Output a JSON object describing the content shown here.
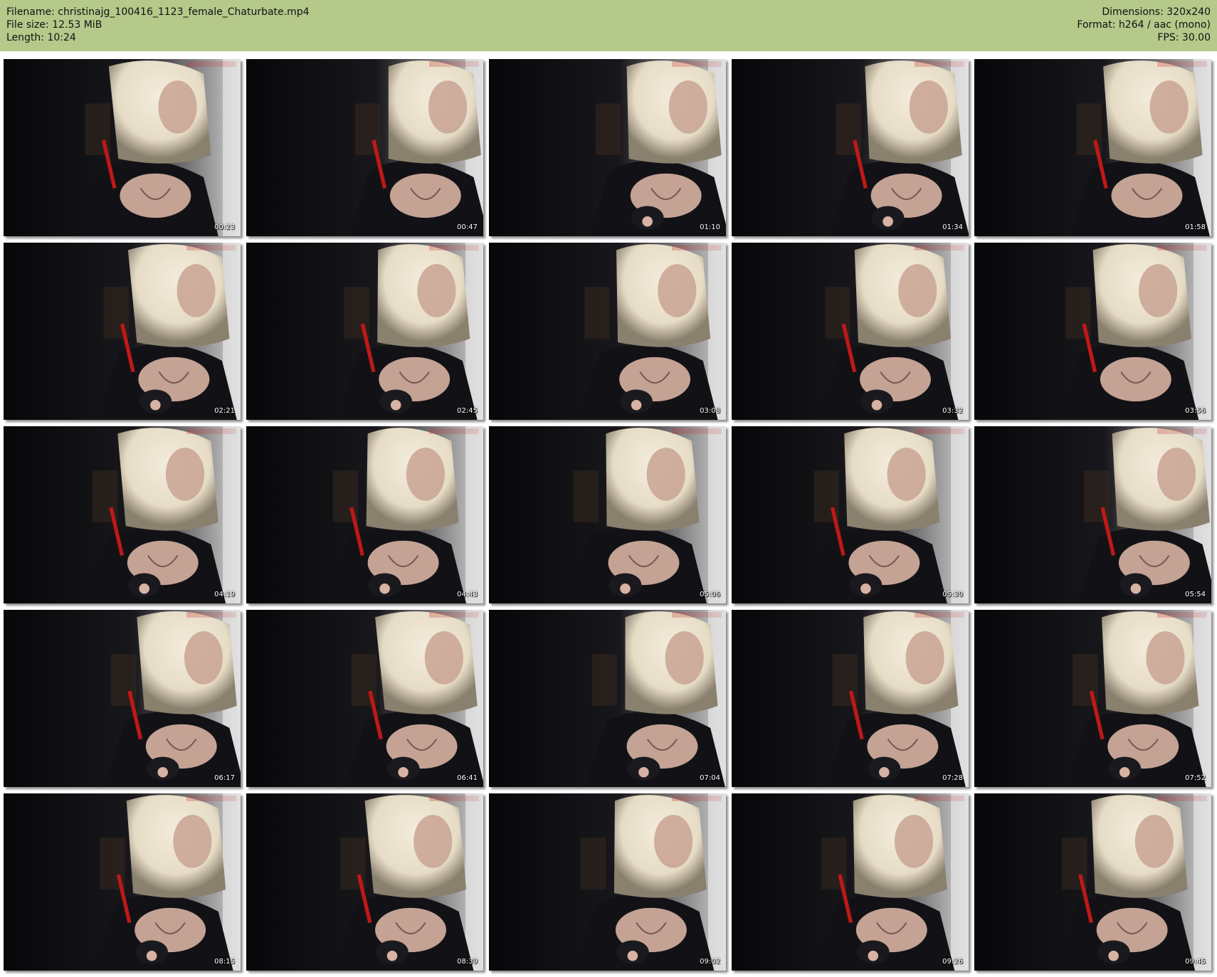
{
  "header": {
    "filename": "Filename: christinajg_100416_1123_female_Chaturbate.mp4",
    "file_size": "File size: 12.53 MiB",
    "length": "Length: 10:24",
    "dimensions": "Dimensions: 320x240",
    "format": "Format: h264 / aac (mono)",
    "fps": "FPS: 30.00"
  },
  "colors": {
    "header_background": "#b4c98a",
    "page_background": "#ffffff",
    "frame_dark": "#0e0e10",
    "hair_light": "#e6dcc6",
    "skin": "#d8b2a2",
    "accent_red": "#c01818"
  },
  "thumbnails": [
    {
      "time": "00:23"
    },
    {
      "time": "00:47"
    },
    {
      "time": "01:10"
    },
    {
      "time": "01:34"
    },
    {
      "time": "01:58"
    },
    {
      "time": "02:21"
    },
    {
      "time": "02:45"
    },
    {
      "time": "03:08"
    },
    {
      "time": "03:32"
    },
    {
      "time": "03:56"
    },
    {
      "time": "04:19"
    },
    {
      "time": "04:43"
    },
    {
      "time": "05:06"
    },
    {
      "time": "05:30"
    },
    {
      "time": "05:54"
    },
    {
      "time": "06:17"
    },
    {
      "time": "06:41"
    },
    {
      "time": "07:04"
    },
    {
      "time": "07:28"
    },
    {
      "time": "07:52"
    },
    {
      "time": "08:15"
    },
    {
      "time": "08:39"
    },
    {
      "time": "09:02"
    },
    {
      "time": "09:26"
    },
    {
      "time": "09:45"
    }
  ]
}
